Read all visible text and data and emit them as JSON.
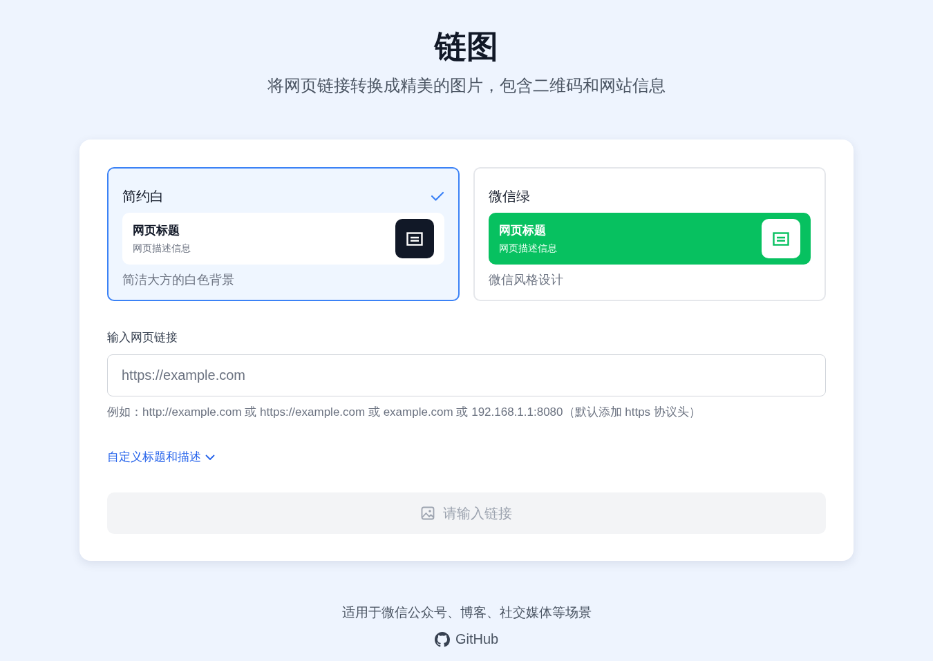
{
  "header": {
    "title": "链图",
    "subtitle": "将网页链接转换成精美的图片，包含二维码和网站信息"
  },
  "themes": [
    {
      "kind": "white",
      "name": "简约白",
      "preview_title": "网页标题",
      "preview_desc": "网页描述信息",
      "description": "简洁大方的白色背景",
      "selected": true
    },
    {
      "kind": "green",
      "name": "微信绿",
      "preview_title": "网页标题",
      "preview_desc": "网页描述信息",
      "description": "微信风格设计",
      "selected": false
    }
  ],
  "url_input": {
    "label": "输入网页链接",
    "placeholder": "https://example.com",
    "hint": "例如：http://example.com 或 https://example.com 或 example.com 或 192.168.1.1:8080（默认添加 https 协议头）"
  },
  "custom_toggle": {
    "label": "自定义标题和描述",
    "expanded": false
  },
  "generate_button": {
    "label": "请输入链接",
    "disabled": true
  },
  "footer": {
    "text": "适用于微信公众号、博客、社交媒体等场景",
    "link": "GitHub"
  }
}
